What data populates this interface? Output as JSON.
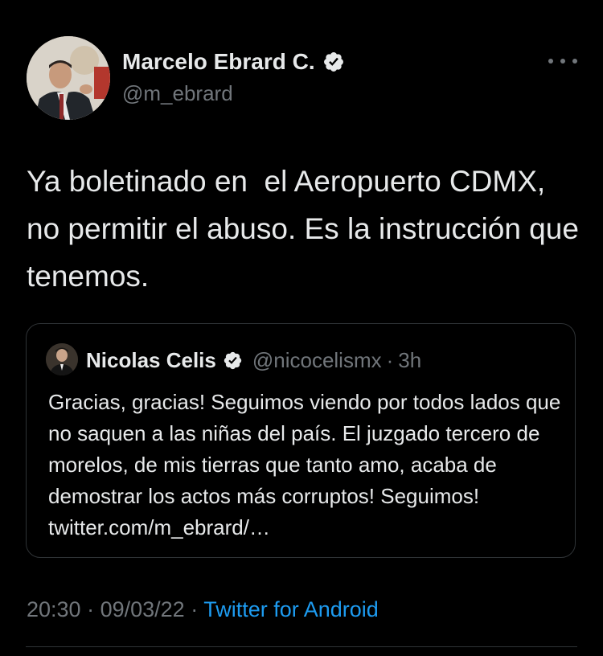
{
  "tweet": {
    "author": {
      "name": "Marcelo Ebrard C.",
      "handle": "@m_ebrard",
      "verified_icon": "verified-badge-icon"
    },
    "more_icon": "more-options-icon",
    "text": "Ya boletinado en  el Aeropuerto CDMX, no permitir el abuso. Es la instrucción que tenemos.",
    "quote": {
      "author": {
        "name": "Nicolas Celis",
        "handle": "@nicocelismx",
        "time": "3h",
        "verified_icon": "verified-badge-icon"
      },
      "separator": "·",
      "text": "Gracias, gracias! Seguimos viendo por todos lados que no saquen a las niñas del país. El juzgado tercero de morelos, de mis tierras que tanto amo, acaba de demostrar los actos más corruptos! Seguimos! twitter.com/m_ebrard/…"
    },
    "meta": {
      "time": "20:30",
      "separator": " · ",
      "date": "09/03/22",
      "source": "Twitter for Android"
    }
  },
  "colors": {
    "background": "#000000",
    "primary_text": "#e7e9ea",
    "secondary_text": "#71767b",
    "link": "#1d9bf0",
    "border": "#2f3336"
  }
}
